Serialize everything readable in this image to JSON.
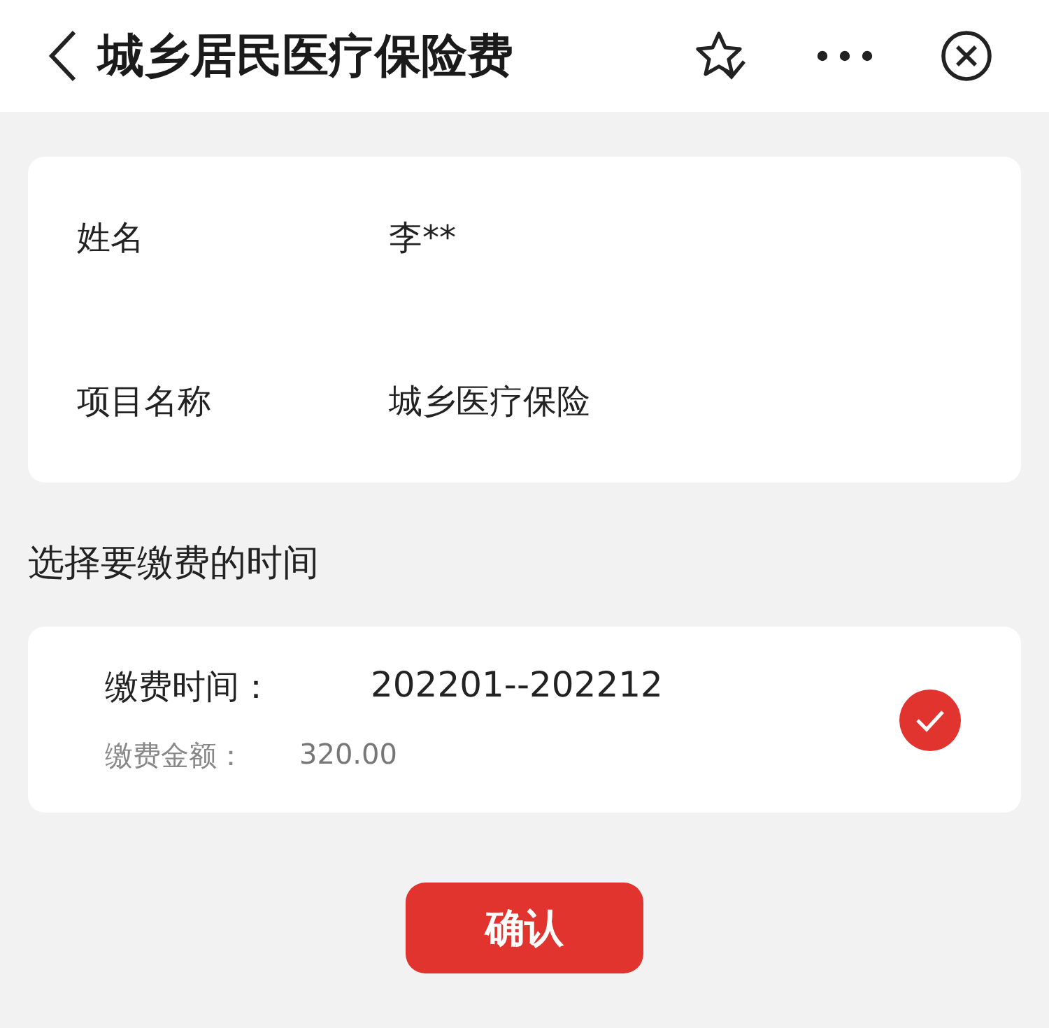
{
  "header": {
    "title": "城乡居民医疗保险费"
  },
  "info": [
    {
      "label": "姓名",
      "value": "李**"
    },
    {
      "label": "项目名称",
      "value": "城乡医疗保险"
    }
  ],
  "section_title": "选择要缴费的时间",
  "options": [
    {
      "time_label": "缴费时间：",
      "time_value": "202201--202212",
      "amount_label": "缴费金额：",
      "amount_value": "320.00",
      "selected": true
    }
  ],
  "confirm_button": "确认"
}
